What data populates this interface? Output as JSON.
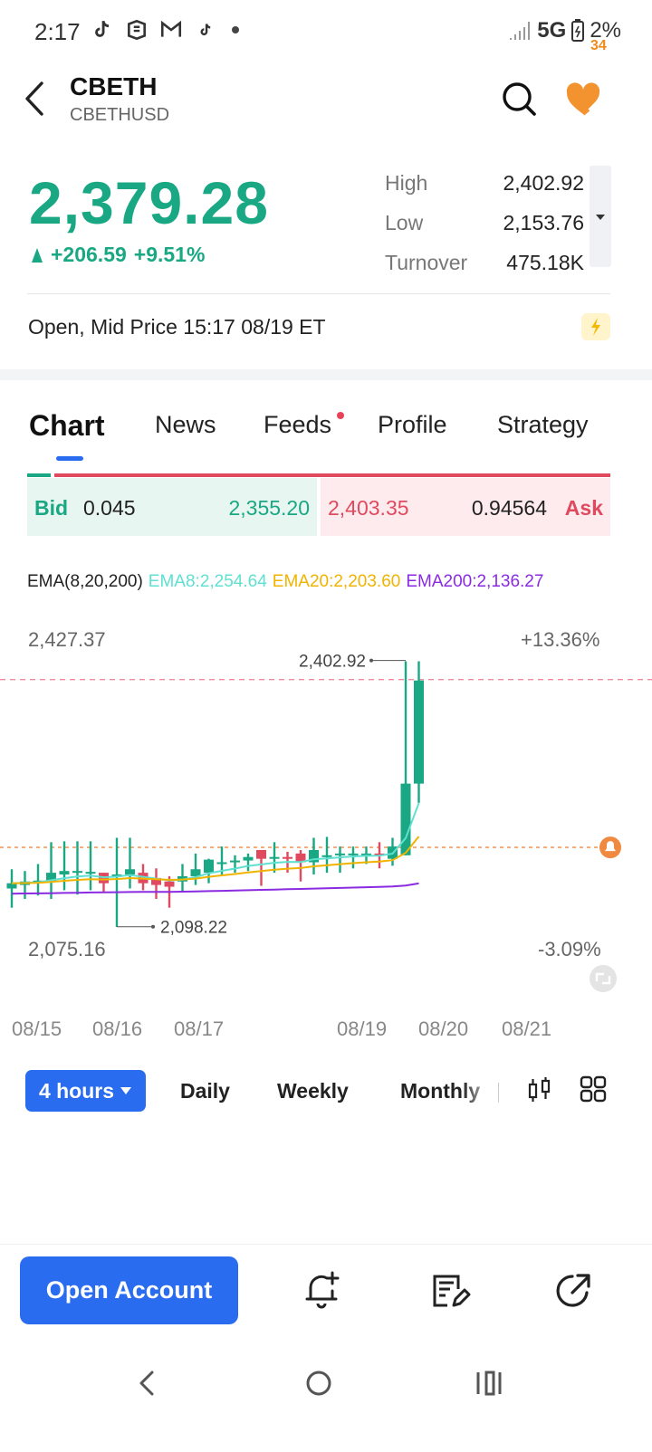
{
  "status_bar": {
    "time": "2:17",
    "network": "5G",
    "battery": "2%"
  },
  "header": {
    "title": "CBETH",
    "subtitle": "CBETHUSD",
    "favorites_count": "34"
  },
  "quote": {
    "price": "2,379.28",
    "change": "+206.59",
    "change_pct": "+9.51%",
    "stats": [
      {
        "label": "High",
        "value": "2,402.92"
      },
      {
        "label": "Low",
        "value": "2,153.76"
      },
      {
        "label": "Turnover",
        "value": "475.18K"
      }
    ],
    "market_status": "Open, Mid Price 15:17 08/19 ET"
  },
  "tabs": [
    {
      "label": "Chart",
      "active": true
    },
    {
      "label": "News",
      "active": false
    },
    {
      "label": "Feeds",
      "active": false,
      "dot": true
    },
    {
      "label": "Profile",
      "active": false
    },
    {
      "label": "Strategy",
      "active": false
    }
  ],
  "order_book": {
    "bid_label": "Bid",
    "bid_size": "0.045",
    "bid_price": "2,355.20",
    "ask_price": "2,403.35",
    "ask_size": "0.94564",
    "ask_label": "Ask"
  },
  "ema": {
    "label": "EMA(8,20,200)",
    "ema8": "EMA8:2,254.64",
    "ema20": "EMA20:2,203.60",
    "ema200": "EMA200:2,136.27",
    "colors": {
      "ema8": "#5fe0d0",
      "ema20": "#f0b400",
      "ema200": "#8a2be2"
    }
  },
  "colors": {
    "up": "#19a883",
    "down": "#e04a5f",
    "accent": "#2a6cf0"
  },
  "chart_data": {
    "type": "candlestick",
    "y_axis": {
      "top": "2,427.37",
      "bottom": "2,075.16",
      "top_pct": "+13.36%",
      "bottom_pct": "-3.09%",
      "range": [
        2075.16,
        2427.37
      ]
    },
    "x_ticks": [
      "08/15",
      "08/16",
      "08/17",
      "08/19",
      "08/20",
      "08/21"
    ],
    "annotations": {
      "high": "2,402.92",
      "low": "2,098.22"
    },
    "candles": [
      {
        "o": 2142,
        "h": 2164,
        "l": 2120,
        "c": 2148
      },
      {
        "o": 2146,
        "h": 2162,
        "l": 2130,
        "c": 2150
      },
      {
        "o": 2148,
        "h": 2170,
        "l": 2134,
        "c": 2151
      },
      {
        "o": 2150,
        "h": 2195,
        "l": 2130,
        "c": 2160
      },
      {
        "o": 2158,
        "h": 2196,
        "l": 2140,
        "c": 2162
      },
      {
        "o": 2160,
        "h": 2196,
        "l": 2135,
        "c": 2162
      },
      {
        "o": 2161,
        "h": 2196,
        "l": 2140,
        "c": 2161
      },
      {
        "o": 2160,
        "h": 2150,
        "l": 2138,
        "c": 2148
      },
      {
        "o": 2156,
        "h": 2200,
        "l": 2098,
        "c": 2158
      },
      {
        "o": 2158,
        "h": 2200,
        "l": 2142,
        "c": 2164
      },
      {
        "o": 2160,
        "h": 2170,
        "l": 2140,
        "c": 2148
      },
      {
        "o": 2154,
        "h": 2165,
        "l": 2130,
        "c": 2146
      },
      {
        "o": 2150,
        "h": 2156,
        "l": 2120,
        "c": 2144
      },
      {
        "o": 2150,
        "h": 2170,
        "l": 2138,
        "c": 2156
      },
      {
        "o": 2156,
        "h": 2182,
        "l": 2146,
        "c": 2164
      },
      {
        "o": 2160,
        "h": 2176,
        "l": 2148,
        "c": 2175
      },
      {
        "o": 2170,
        "h": 2190,
        "l": 2158,
        "c": 2172
      },
      {
        "o": 2172,
        "h": 2180,
        "l": 2160,
        "c": 2174
      },
      {
        "o": 2174,
        "h": 2182,
        "l": 2162,
        "c": 2178
      },
      {
        "o": 2186,
        "h": 2186,
        "l": 2145,
        "c": 2176
      },
      {
        "o": 2176,
        "h": 2195,
        "l": 2160,
        "c": 2178
      },
      {
        "o": 2178,
        "h": 2184,
        "l": 2160,
        "c": 2176
      },
      {
        "o": 2182,
        "h": 2186,
        "l": 2150,
        "c": 2172
      },
      {
        "o": 2172,
        "h": 2200,
        "l": 2158,
        "c": 2186
      },
      {
        "o": 2178,
        "h": 2201,
        "l": 2160,
        "c": 2180
      },
      {
        "o": 2180,
        "h": 2190,
        "l": 2160,
        "c": 2182
      },
      {
        "o": 2182,
        "h": 2190,
        "l": 2165,
        "c": 2182
      },
      {
        "o": 2182,
        "h": 2190,
        "l": 2170,
        "c": 2182
      },
      {
        "o": 2182,
        "h": 2195,
        "l": 2165,
        "c": 2180
      },
      {
        "o": 2176,
        "h": 2200,
        "l": 2168,
        "c": 2190
      },
      {
        "o": 2180,
        "h": 2402,
        "l": 2180,
        "c": 2262
      },
      {
        "o": 2262,
        "h": 2402,
        "l": 2240,
        "c": 2380
      }
    ]
  },
  "periods": {
    "active": "4 hours",
    "items": [
      "Daily",
      "Weekly",
      "Monthly"
    ]
  },
  "bottom": {
    "open_account": "Open Account"
  }
}
